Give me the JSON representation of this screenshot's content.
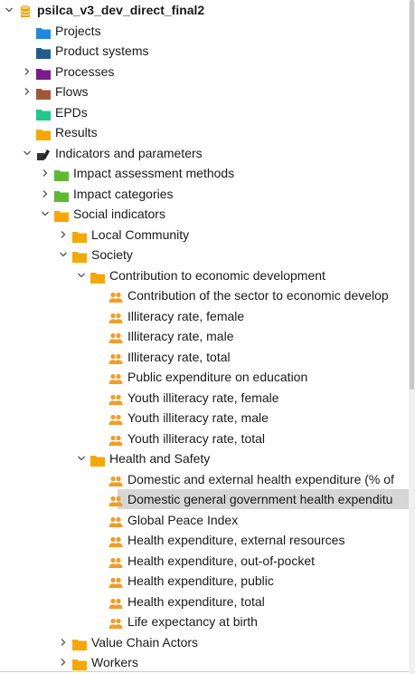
{
  "colors": {
    "db": "#f0a30a",
    "project": "#1e88e5",
    "product_system": "#1f5d8c",
    "process": "#7b1a8a",
    "flow": "#a0583a",
    "epd": "#1ec98c",
    "results": "#f5a800",
    "green_folder": "#5fb832",
    "orange_folder": "#f5a800",
    "people": "#f39c26"
  },
  "tree": [
    {
      "label": "psilca_v3_dev_direct_final2",
      "icon": "database-icon",
      "level": 0,
      "chevron": "down",
      "bold": true
    },
    {
      "label": "Projects",
      "icon": "folder-icon",
      "color": "#1e88e5",
      "level": 1,
      "chevron": "none"
    },
    {
      "label": "Product systems",
      "icon": "folder-icon",
      "color": "#1f5d8c",
      "level": 1,
      "chevron": "none"
    },
    {
      "label": "Processes",
      "icon": "folder-icon",
      "color": "#7b1a8a",
      "level": 1,
      "chevron": "right"
    },
    {
      "label": "Flows",
      "icon": "folder-icon",
      "color": "#a0583a",
      "level": 1,
      "chevron": "right"
    },
    {
      "label": "EPDs",
      "icon": "folder-icon",
      "color": "#1ec98c",
      "level": 1,
      "chevron": "none"
    },
    {
      "label": "Results",
      "icon": "folder-icon",
      "color": "#f5a800",
      "level": 1,
      "chevron": "none"
    },
    {
      "label": "Indicators and parameters",
      "icon": "indicators-icon",
      "level": 1,
      "chevron": "down"
    },
    {
      "label": "Impact assessment methods",
      "icon": "folder-icon",
      "color": "#5fb832",
      "level": 2,
      "chevron": "right"
    },
    {
      "label": "Impact categories",
      "icon": "folder-icon",
      "color": "#5fb832",
      "level": 2,
      "chevron": "right"
    },
    {
      "label": "Social indicators",
      "icon": "folder-icon",
      "color": "#f5a800",
      "level": 2,
      "chevron": "down"
    },
    {
      "label": "Local Community",
      "icon": "folder-icon",
      "color": "#f5a800",
      "level": 3,
      "chevron": "right"
    },
    {
      "label": "Society",
      "icon": "folder-icon",
      "color": "#f5a800",
      "level": 3,
      "chevron": "down"
    },
    {
      "label": "Contribution to economic development",
      "icon": "folder-icon",
      "color": "#f5a800",
      "level": 4,
      "chevron": "down"
    },
    {
      "label": "Contribution of the sector to economic develop",
      "icon": "people-icon",
      "level": 5,
      "chevron": "none"
    },
    {
      "label": "Illiteracy rate, female",
      "icon": "people-icon",
      "level": 5,
      "chevron": "none"
    },
    {
      "label": "Illiteracy rate, male",
      "icon": "people-icon",
      "level": 5,
      "chevron": "none"
    },
    {
      "label": "Illiteracy rate, total",
      "icon": "people-icon",
      "level": 5,
      "chevron": "none"
    },
    {
      "label": "Public expenditure on education",
      "icon": "people-icon",
      "level": 5,
      "chevron": "none"
    },
    {
      "label": "Youth illiteracy rate, female",
      "icon": "people-icon",
      "level": 5,
      "chevron": "none"
    },
    {
      "label": "Youth illiteracy rate, male",
      "icon": "people-icon",
      "level": 5,
      "chevron": "none"
    },
    {
      "label": "Youth illiteracy rate, total",
      "icon": "people-icon",
      "level": 5,
      "chevron": "none"
    },
    {
      "label": "Health and Safety",
      "icon": "folder-icon",
      "color": "#f5a800",
      "level": 4,
      "chevron": "down"
    },
    {
      "label": "Domestic and external health expenditure (% of",
      "icon": "people-icon",
      "level": 5,
      "chevron": "none"
    },
    {
      "label": "Domestic general government health expenditu",
      "icon": "people-icon",
      "level": 5,
      "chevron": "none",
      "selected": true
    },
    {
      "label": "Global Peace Index",
      "icon": "people-icon",
      "level": 5,
      "chevron": "none"
    },
    {
      "label": "Health expenditure, external resources",
      "icon": "people-icon",
      "level": 5,
      "chevron": "none"
    },
    {
      "label": "Health expenditure, out-of-pocket",
      "icon": "people-icon",
      "level": 5,
      "chevron": "none"
    },
    {
      "label": "Health expenditure, public",
      "icon": "people-icon",
      "level": 5,
      "chevron": "none"
    },
    {
      "label": "Health expenditure, total",
      "icon": "people-icon",
      "level": 5,
      "chevron": "none"
    },
    {
      "label": "Life expectancy at birth",
      "icon": "people-icon",
      "level": 5,
      "chevron": "none"
    },
    {
      "label": "Value Chain Actors",
      "icon": "folder-icon",
      "color": "#f5a800",
      "level": 3,
      "chevron": "right"
    },
    {
      "label": "Workers",
      "icon": "folder-icon",
      "color": "#f5a800",
      "level": 3,
      "chevron": "right"
    }
  ]
}
